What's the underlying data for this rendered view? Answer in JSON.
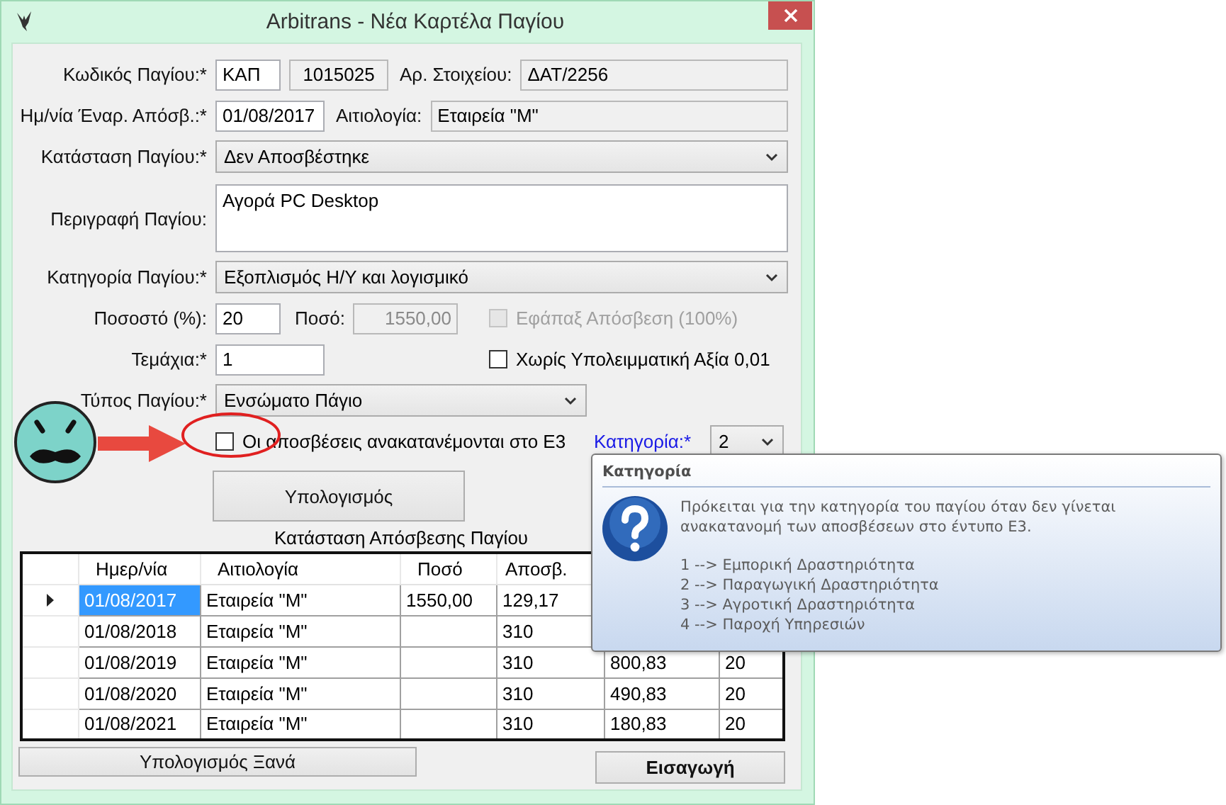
{
  "window": {
    "title": "Arbitrans - Νέα Καρτέλα Παγίου"
  },
  "form": {
    "asset_code": {
      "label": "Κωδικός Παγίου:*",
      "prefix": "ΚΑΠ",
      "number": "1015025"
    },
    "item_no": {
      "label": "Αρ. Στοιχείου:",
      "value": "ΔΑΤ/2256"
    },
    "start_date": {
      "label": "Ημ/νία Έναρ. Απόσβ.:*",
      "value": "01/08/2017"
    },
    "reason": {
      "label": "Αιτιολογία:",
      "value": "Εταιρεία \"M\""
    },
    "status": {
      "label": "Κατάσταση Παγίου:*",
      "value": "Δεν Αποσβέστηκε"
    },
    "description": {
      "label": "Περιγραφή Παγίου:",
      "value": "Αγορά PC Desktop"
    },
    "category": {
      "label": "Κατηγορία Παγίου:*",
      "value": "Εξοπλισμός Η/Υ και λογισμικό"
    },
    "percent": {
      "label": "Ποσοστό (%):",
      "value": "20"
    },
    "amount": {
      "label": "Ποσό:",
      "value": "1550,00",
      "disabled": true
    },
    "lump_sum": {
      "label": "Εφάπαξ Απόσβεση (100%)",
      "checked": false,
      "disabled": true
    },
    "pieces": {
      "label": "Τεμάχια:*",
      "value": "1"
    },
    "no_residual": {
      "label": "Χωρίς Υπολειμματική Αξία 0,01",
      "checked": false,
      "disabled": false
    },
    "asset_type": {
      "label": "Τύπος Παγίου:*",
      "value": "Ενσώματο Πάγιο"
    },
    "redistribute": {
      "label": "Οι αποσβέσεις ανακατανέμονται στο Ε3",
      "checked": false,
      "disabled": false
    },
    "e3_category": {
      "label": "Κατηγορία:*",
      "value": "2"
    },
    "calculate_button": "Υπολογισμός"
  },
  "table": {
    "caption": "Κατάσταση Απόσβεσης Παγίου",
    "columns": [
      "Ημερ/νία",
      "Αιτιολογία",
      "Ποσό",
      "Αποσβ."
    ],
    "rows": [
      {
        "selected": true,
        "cells": [
          "01/08/2017",
          "Εταιρεία \"M\"",
          "1550,00",
          "129,17"
        ]
      },
      {
        "selected": false,
        "cells": [
          "01/08/2018",
          "Εταιρεία \"M\"",
          "",
          "310"
        ]
      },
      {
        "selected": false,
        "cells": [
          "01/08/2019",
          "Εταιρεία \"M\"",
          "",
          "310",
          "800,83",
          "20"
        ]
      },
      {
        "selected": false,
        "cells": [
          "01/08/2020",
          "Εταιρεία \"M\"",
          "",
          "310",
          "490,83",
          "20"
        ]
      },
      {
        "selected": false,
        "cells": [
          "01/08/2021",
          "Εταιρεία \"M\"",
          "",
          "310",
          "180,83",
          "20"
        ]
      }
    ]
  },
  "buttons": [
    {
      "label": "Υπολογισμός Ξανά",
      "kind": "plain"
    },
    {
      "label": "Εισαγωγή",
      "kind": "default"
    }
  ],
  "tooltip": {
    "title": "Κατηγορία",
    "text": "Πρόκειται για την κατηγορία του παγίου όταν δεν γίνεται ανακατανομή των αποσβέσεων στο έντυπο Ε3.",
    "items": [
      "1 --> Εμπορική Δραστηριότητα",
      "2 --> Παραγωγική Δραστηριότητα",
      "3 --> Αγροτική Δραστηριότητα",
      "4 --> Παροχή Υπηρεσιών"
    ]
  }
}
